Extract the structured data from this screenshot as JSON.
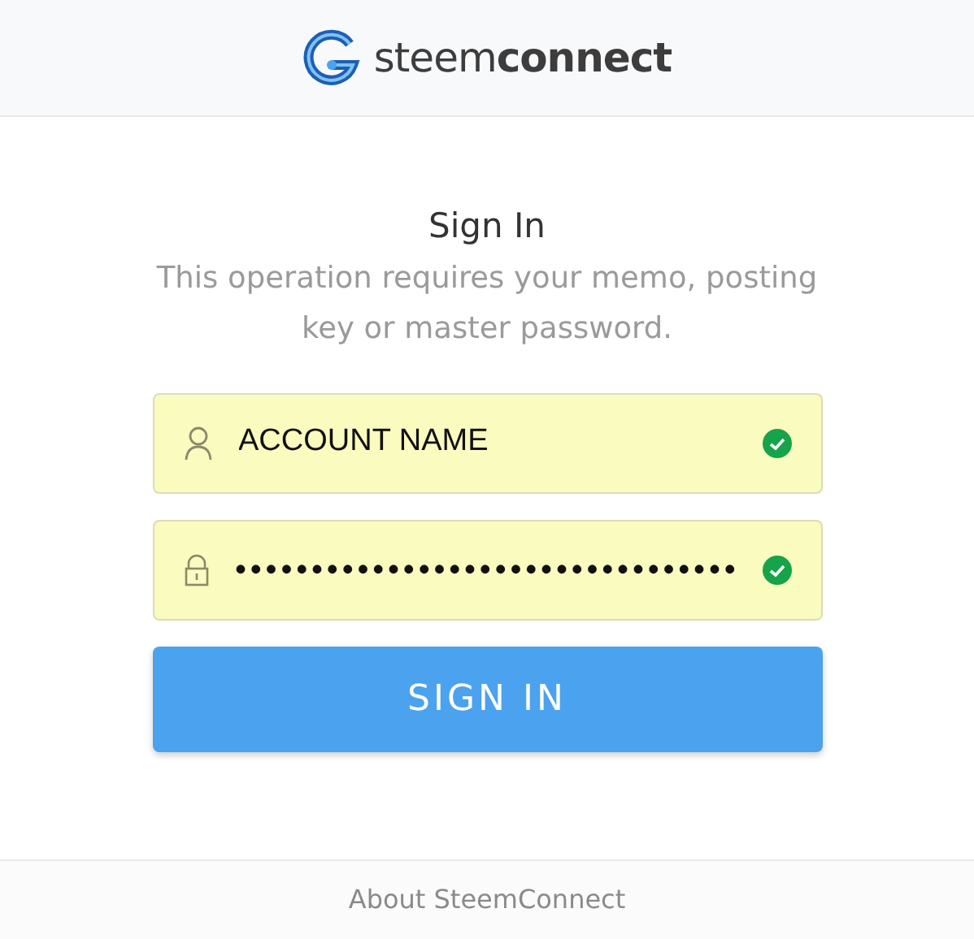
{
  "header": {
    "logo_text": "steem**connect**"
  },
  "form": {
    "title": "Sign In",
    "subtitle": "This operation requires your memo, posting key or master password.",
    "fields": [
      {
        "kind": "user",
        "value": "ACCOUNT NAME",
        "valid": true
      },
      {
        "kind": "password",
        "value": "•••••••••••••••••••••••••••••••••",
        "valid": true
      }
    ],
    "submit": "SIGN IN"
  },
  "footer": {
    "link": "About SteemConnect"
  }
}
